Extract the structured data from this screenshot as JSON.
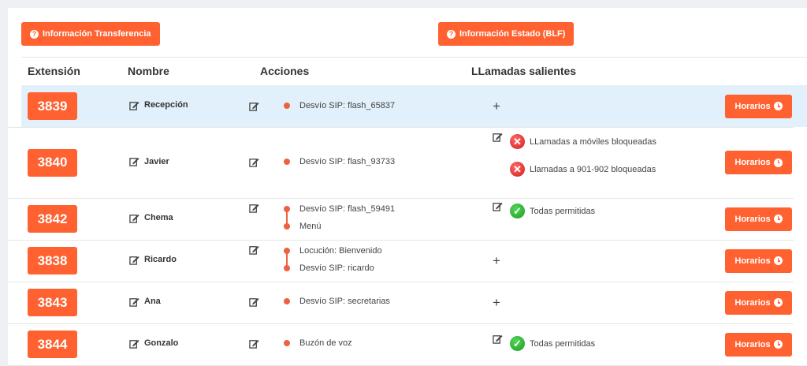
{
  "top_buttons": {
    "transfer": "Información Transferencia",
    "blf": "Información Estado (BLF)"
  },
  "headers": {
    "extension": "Extensión",
    "name": "Nombre",
    "actions": "Acciones",
    "outgoing": "LLamadas salientes"
  },
  "horarios_label": "Horarios",
  "rows": [
    {
      "ext": "3839",
      "name": "Recepción",
      "actions": [
        "Desvío SIP: flash_65837"
      ],
      "outgoing": [],
      "highlighted": true
    },
    {
      "ext": "3840",
      "name": "Javier",
      "actions": [
        "Desvío SIP: flash_93733"
      ],
      "outgoing": [
        {
          "icon": "blocked-icon",
          "text": "LLamadas a móviles bloqueadas"
        },
        {
          "icon": "blocked-icon",
          "text": "Llamadas a 901-902 bloqueadas"
        }
      ]
    },
    {
      "ext": "3842",
      "name": "Chema",
      "actions": [
        "Desvío SIP: flash_59491",
        "Menú"
      ],
      "outgoing": [
        {
          "icon": "allowed-icon",
          "text": "Todas permitidas"
        }
      ]
    },
    {
      "ext": "3838",
      "name": "Ricardo",
      "actions": [
        "Locución: Bienvenido",
        "Desvío SIP: ricardo"
      ],
      "outgoing": []
    },
    {
      "ext": "3843",
      "name": "Ana",
      "actions": [
        "Desvío SIP: secretarias"
      ],
      "outgoing": []
    },
    {
      "ext": "3844",
      "name": "Gonzalo",
      "actions": [
        "Buzón de voz"
      ],
      "outgoing": [
        {
          "icon": "allowed-icon",
          "text": "Todas permitidas"
        }
      ]
    }
  ],
  "colors": {
    "accent": "#ff6131",
    "highlight": "#e1f0fb",
    "dot": "#ee6141"
  }
}
